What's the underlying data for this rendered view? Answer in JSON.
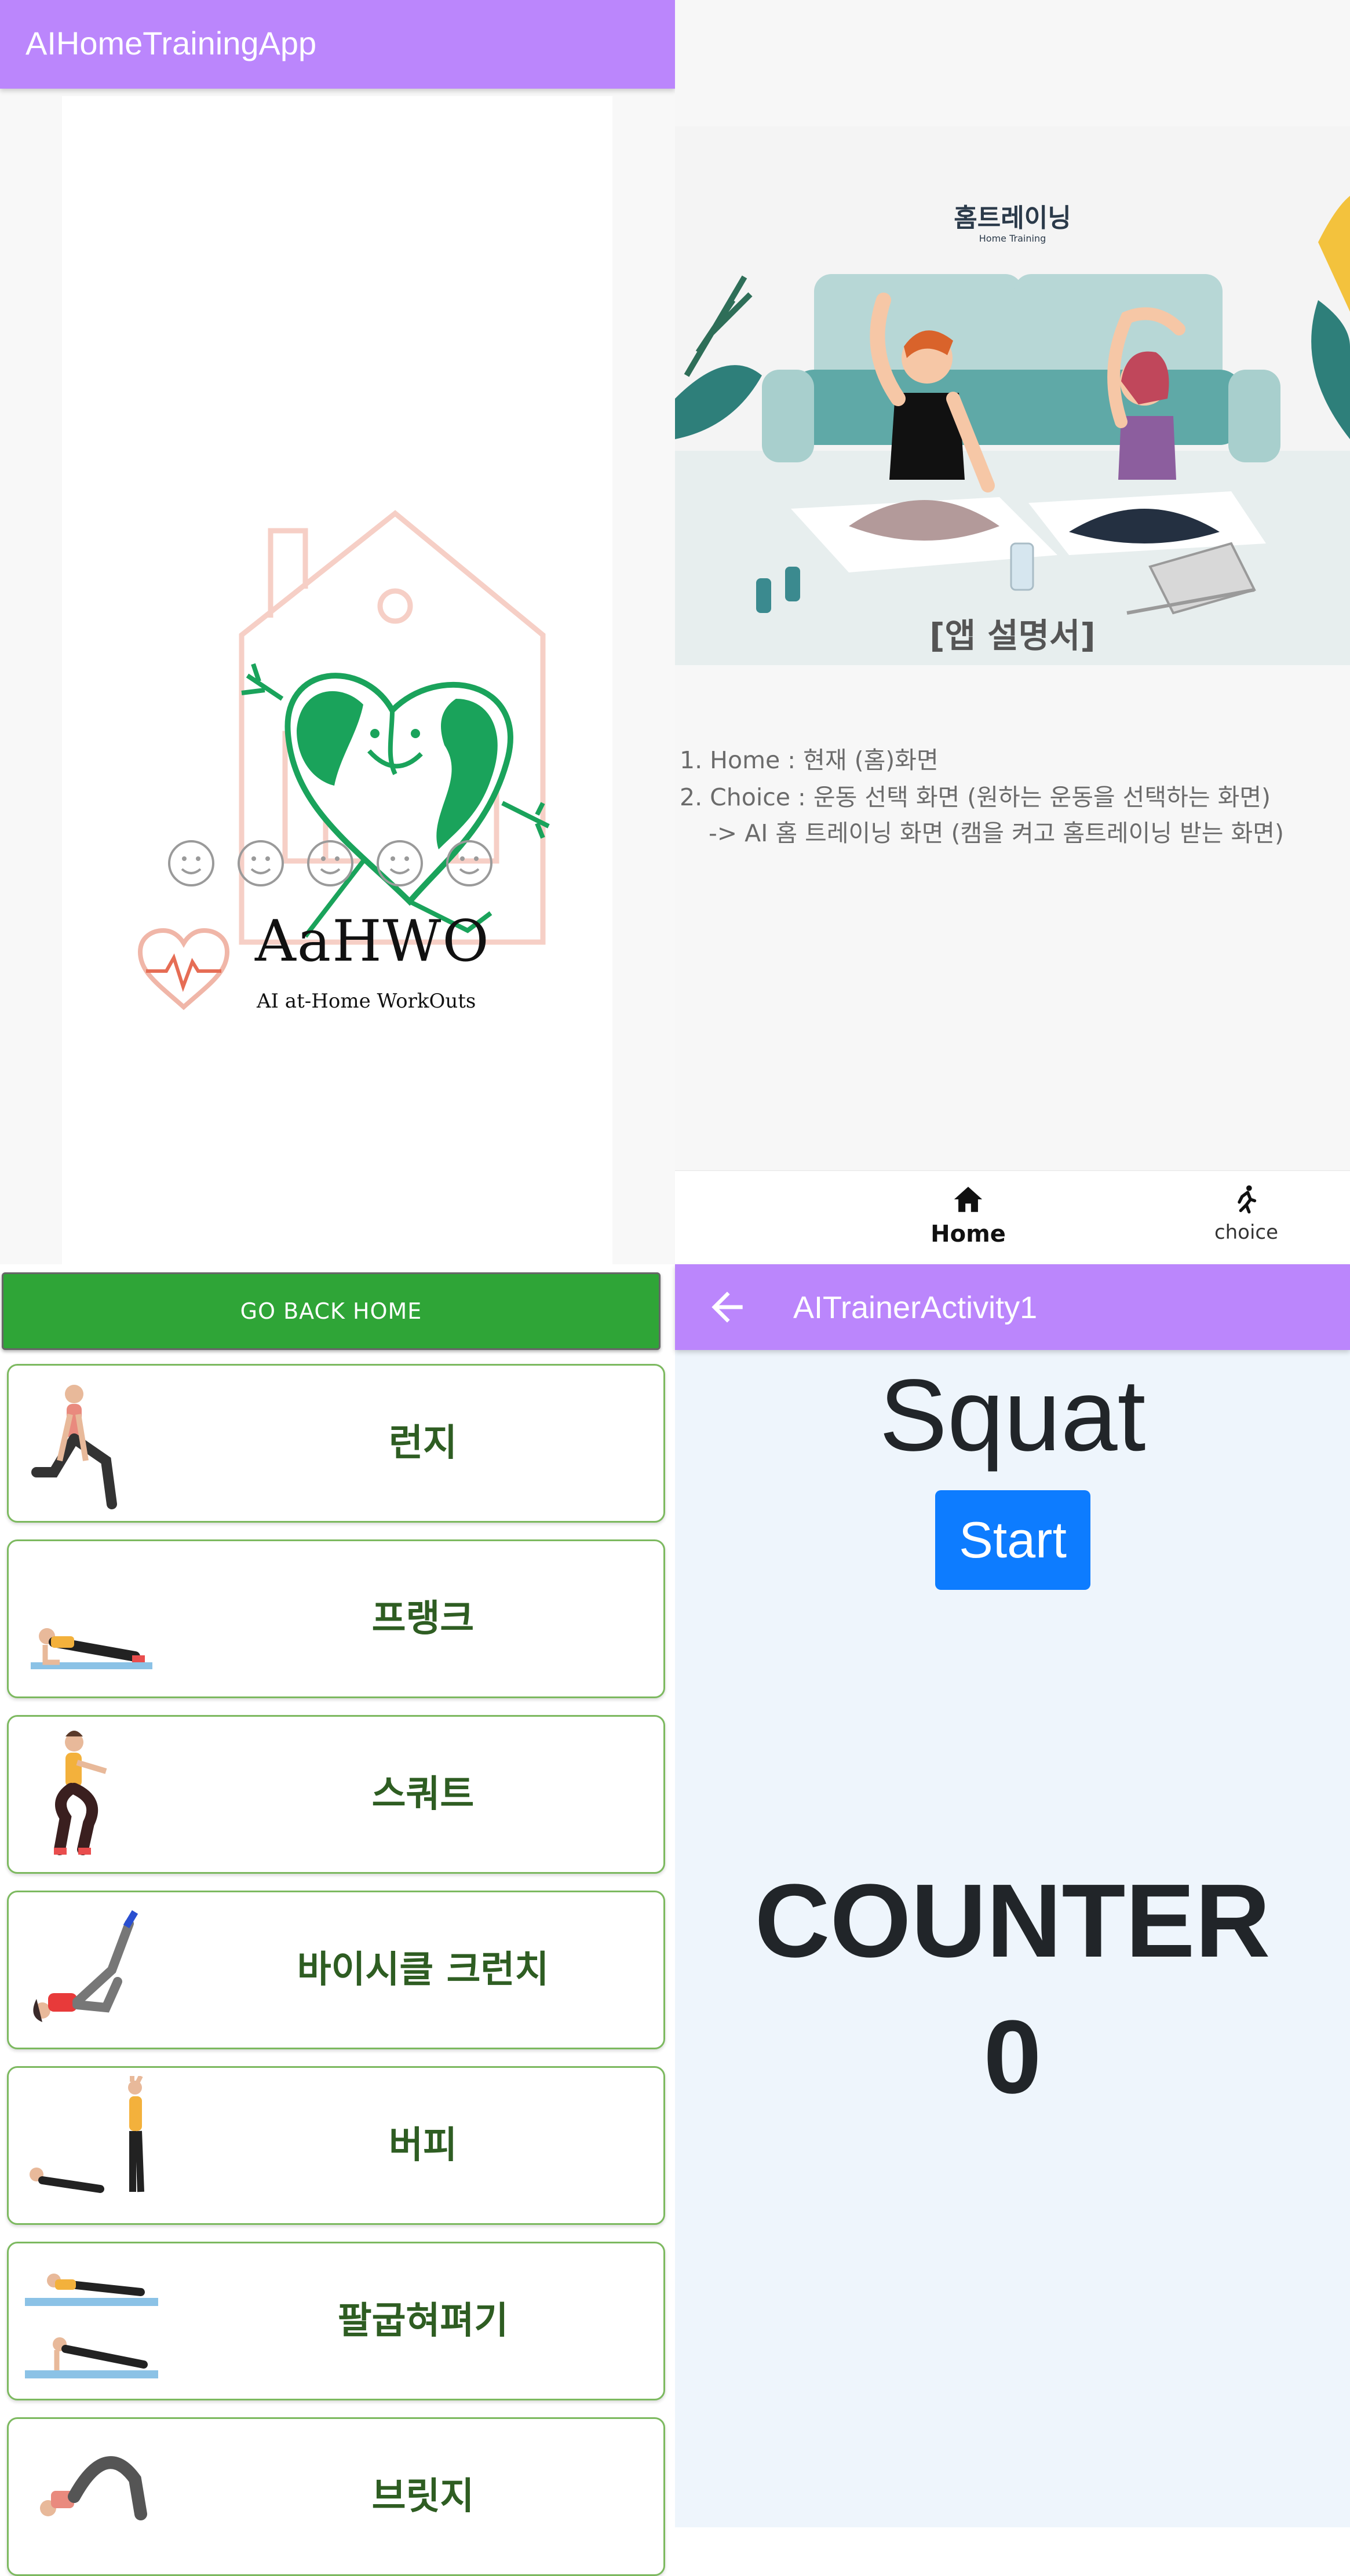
{
  "splash": {
    "app_title": "AIHomeTrainingApp",
    "brand_name": "AaHWO",
    "brand_tagline": "AI at-Home WorkOuts"
  },
  "home": {
    "guide_title": "홈트레이닝",
    "guide_subtitle": "Home Training",
    "guide_caption": "[앱 설명서]",
    "guide_lines": [
      "1. Home : 현재 (홈)화면",
      "2. Choice : 운동 선택 화면 (원하는 운동을 선택하는 화면)",
      "-> AI 홈 트레이닝 화면 (캠을 켜고 홈트레이닝 받는 화면)"
    ],
    "nav": {
      "home_label": "Home",
      "choice_label": "choice"
    }
  },
  "choice": {
    "go_back_label": "GO BACK HOME",
    "exercises": [
      {
        "label": "런지"
      },
      {
        "label": "프랭크"
      },
      {
        "label": "스쿼트"
      },
      {
        "label": "바이시클 크런치"
      },
      {
        "label": "버피"
      },
      {
        "label": "팔굽혀펴기"
      },
      {
        "label": "브릿지"
      }
    ]
  },
  "trainer": {
    "title": "AITrainerActivity1",
    "exercise_name": "Squat",
    "start_label": "Start",
    "counter_label": "COUNTER",
    "counter_value": "0"
  },
  "colors": {
    "appbar": "#bb86fc",
    "go_back": "#2fa537",
    "exercise_text": "#2e5d22",
    "start_button": "#0d7cff",
    "trainer_bg": "#eef5fc"
  },
  "icons": {
    "back": "arrow-left-icon",
    "home": "home-icon",
    "choice": "running-person-icon"
  }
}
